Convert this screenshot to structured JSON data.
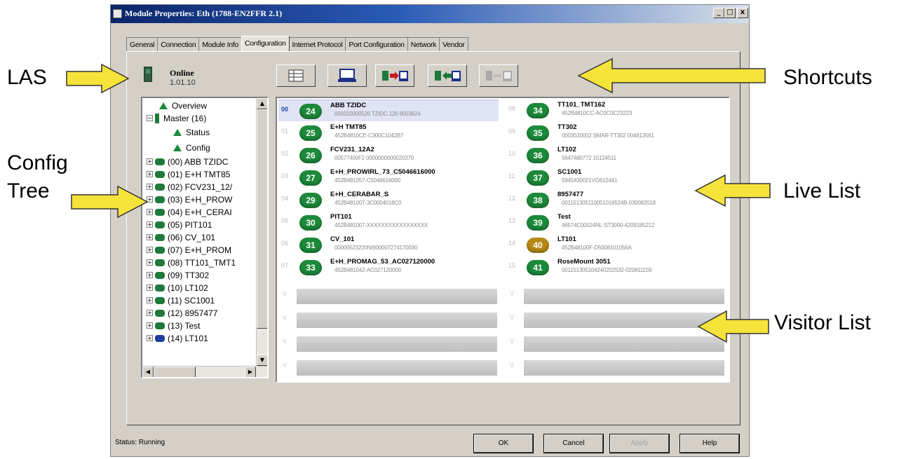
{
  "window": {
    "title": "Module Properties: Eth (1788-EN2FFR 2.1)",
    "minimize_glyph": "_",
    "restore_glyph": "□",
    "close_glyph": "x"
  },
  "tabs": [
    "General",
    "Connection",
    "Module Info",
    "Configuration",
    "Internet Protocol",
    "Port Configuration",
    "Network",
    "Vendor"
  ],
  "active_tab": "Configuration",
  "las": {
    "status": "Online",
    "version": "1.01.10"
  },
  "toolbar": {
    "buttons": [
      "grid-view-icon",
      "monitor-icon",
      "transfer-right-icon",
      "transfer-left-icon",
      "transfer-disabled-icon"
    ]
  },
  "tree": {
    "overview": "Overview",
    "master": "Master (16)",
    "status": "Status",
    "config": "Config",
    "devices": [
      "(00) ABB TZIDC",
      "(01) E+H TMT85",
      "(02) FCV231_12/",
      "(03) E+H_PROW",
      "(04) E+H_CERAI",
      "(05) PIT101",
      "(06) CV_101",
      "(07) E+H_PROM",
      "(08) TT101_TMT1",
      "(09) TT302",
      "(10) LT102",
      "(11) SC1001",
      "(12) 8957477",
      "(13) Test",
      "(14) LT101"
    ]
  },
  "live_list": {
    "left": [
      {
        "num": "00",
        "addr": "24",
        "name": "ABB TZIDC",
        "id": "000320000526        TZIDC-120 8003624"
      },
      {
        "num": "01",
        "addr": "25",
        "name": "E+H TMT85",
        "id": "452B4810CE-C300C1042B7"
      },
      {
        "num": "02",
        "addr": "26",
        "name": "FCV231_12A2",
        "id": "00577400F2    0000000000020370"
      },
      {
        "num": "03",
        "addr": "27",
        "name": "E+H_PROWIRL_73_C5046616000",
        "id": "452B481057-C5046616000"
      },
      {
        "num": "04",
        "addr": "29",
        "name": "E+H_CERABAR_S",
        "id": "452B481007-3C0004018C0"
      },
      {
        "num": "05",
        "addr": "30",
        "name": "PIT101",
        "id": "452B481007-XXXXXXXXXXXXXXXXX"
      },
      {
        "num": "06",
        "addr": "31",
        "name": "CV_101",
        "id": "00000523220NI900007274170030"
      },
      {
        "num": "07",
        "addr": "33",
        "name": "E+H_PROMAG_53_AC027120000",
        "id": "452B481042-AC027120000"
      }
    ],
    "right": [
      {
        "num": "08",
        "addr": "34",
        "name": "TT101_TMT162",
        "id": "452B4810CC-AC0C0C23223"
      },
      {
        "num": "09",
        "addr": "35",
        "name": "TT302",
        "id": "0003020002 SMAR-TT302 004813561"
      },
      {
        "num": "10",
        "addr": "36",
        "name": "LT102",
        "id": "5647480772           15124511"
      },
      {
        "num": "11",
        "addr": "37",
        "name": "SC1001",
        "id": "5945430021VG612441"
      },
      {
        "num": "12",
        "addr": "38",
        "name": "8957477",
        "id": "001151305110051016524B-030082018"
      },
      {
        "num": "13",
        "addr": "39",
        "name": "Test",
        "id": "46574C00024NL-ST3000-4209185212"
      },
      {
        "num": "14",
        "addr": "40",
        "name": "LT101",
        "id": "452B48100F-D5008101056A"
      },
      {
        "num": "15",
        "addr": "41",
        "name": "RoseMount 3051",
        "id": "001151305104240202532-020811159"
      }
    ]
  },
  "visitor": {
    "label": "V"
  },
  "status_bar": {
    "text": "Status:  Running"
  },
  "buttons": {
    "ok": "OK",
    "cancel": "Cancel",
    "apply": "Apply",
    "help": "Help"
  },
  "annotations": {
    "las": "LAS",
    "config_tree_line1": "Config",
    "config_tree_line2": "Tree",
    "shortcuts": "Shortcuts",
    "live_list": "Live List",
    "visitor_list": "Visitor List"
  },
  "colors": {
    "badge_green": "#1c8a3a",
    "badge_gold": "#b78a15",
    "arrow_yellow": "#f6e33a",
    "title_blue": "#0a246a"
  }
}
